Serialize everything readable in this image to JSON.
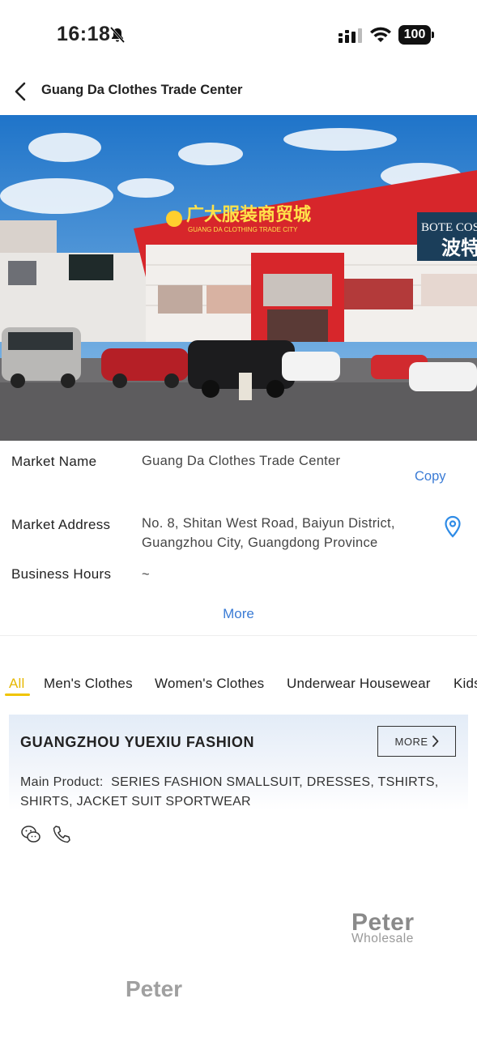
{
  "status_bar": {
    "time": "16:18",
    "battery": "100"
  },
  "header": {
    "title": "Guang Da Clothes Trade Center"
  },
  "hero": {
    "sign_main": "广大服装商贸城",
    "sign_sub": "GUANG DA CLOTHING TRADE CITY",
    "sign_right": "BOTE COST",
    "sign_right_cn": "波特"
  },
  "info": {
    "market_name_label": "Market Name",
    "market_name_value": "Guang Da Clothes Trade Center",
    "copy_label": "Copy",
    "address_label": "Market Address",
    "address_line1": "No. 8, Shitan West Road, Baiyun District,",
    "address_line2": "Guangzhou City, Guangdong Province",
    "hours_label": "Business Hours",
    "hours_value": "~",
    "more_label": "More"
  },
  "tabs": [
    {
      "label": "All"
    },
    {
      "label": "Men's Clothes"
    },
    {
      "label": "Women's Clothes"
    },
    {
      "label": "Underwear Housewear"
    },
    {
      "label": "Kids"
    }
  ],
  "shops": [
    {
      "name": "GUANGZHOU YUEXIU FASHION",
      "more_label": "MORE",
      "main_product_label": "Main Product:",
      "main_product": "SERIES FASHION SMALLSUIT, DRESSES, TSHIRTS, SHIRTS, JACKET SUIT SPORTWEAR"
    }
  ],
  "watermarks": {
    "wm1": "Peter",
    "wm1_sub": "Wholesale",
    "wm2": "Peter"
  },
  "colors": {
    "accent": "#3a7bd5",
    "tab_active": "#e6b800",
    "brand_red": "#d7262b"
  }
}
